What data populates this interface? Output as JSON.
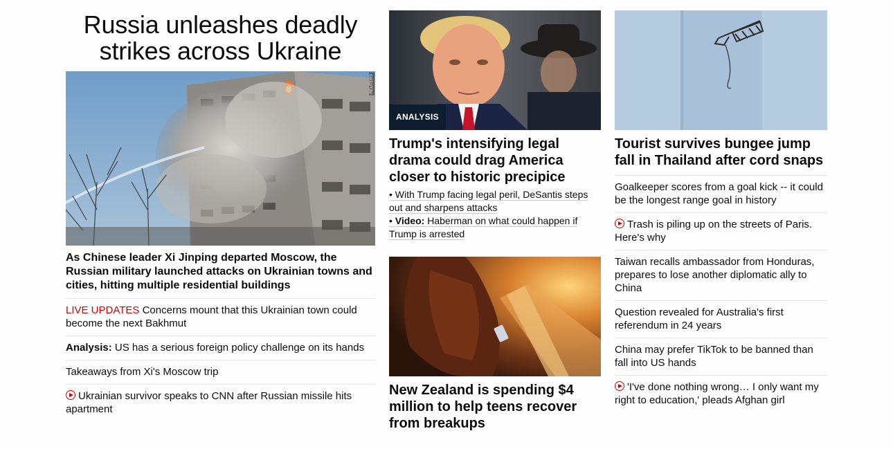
{
  "col1": {
    "big_headline": "Russia unleashes deadly strikes across Ukraine",
    "image_credit": "REUTERS",
    "lead_headline": "As Chinese leader Xi Jinping departed Moscow, the Russian military launched attacks on Ukrainian towns and cities, hitting multiple residential buildings",
    "links": [
      {
        "prefix": "LIVE UPDATES",
        "text": " Concerns mount that this Ukrainian town could become the next Bakhmut"
      },
      {
        "prefix": "Analysis:",
        "text": " US has a serious foreign policy challenge on its hands"
      },
      {
        "text": "Takeaways from Xi's Moscow trip"
      },
      {
        "text": "Ukrainian survivor speaks to CNN after Russian missile hits apartment",
        "icon": "play-icon"
      }
    ]
  },
  "col2": {
    "story1": {
      "badge": "ANALYSIS",
      "headline": "Trump's intensifying legal drama could drag America closer to historic precipice",
      "sublinks": [
        {
          "bullet": "•",
          "text": "With Trump facing legal peril, DeSantis steps out and sharpens attacks"
        },
        {
          "bullet": "•",
          "prefix": "Video:",
          "text": "Haberman on what could happen if Trump is arrested"
        }
      ]
    },
    "story2": {
      "headline": "New Zealand is spending $4 million to help teens recover from breakups"
    }
  },
  "col3": {
    "headline": "Tourist survives bungee jump fall in Thailand after cord snaps",
    "links": [
      {
        "text": "Goalkeeper scores from a goal kick -- it could be the longest range goal in history"
      },
      {
        "text": "Trash is piling up on the streets of Paris. Here's why",
        "icon": "play-icon"
      },
      {
        "text": "Taiwan recalls ambassador from Honduras, prepares to lose another diplomatic ally to China"
      },
      {
        "text": "Question revealed for Australia's first referendum in 24 years"
      },
      {
        "text": "China may prefer TikTok to be banned than fall into US hands"
      },
      {
        "text": "'I've done nothing wrong… I only want my right to education,' pleads Afghan girl",
        "icon": "play-icon"
      }
    ]
  },
  "colors": {
    "accent_red": "#cc0000",
    "badge_bg": "#0c1d2e",
    "text": "#0c0c0c",
    "divider": "#e6e6e6"
  }
}
